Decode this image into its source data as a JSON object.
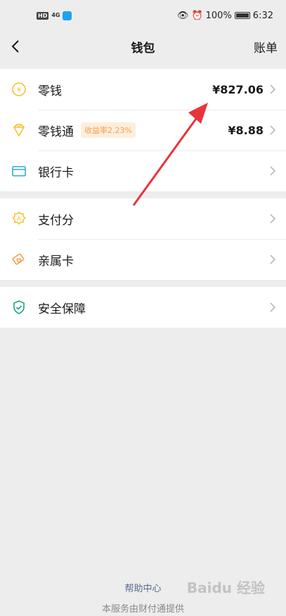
{
  "status_bar": {
    "hd": "HD",
    "signal": "4G",
    "battery_text": "100%",
    "time": "6:32"
  },
  "nav": {
    "title": "钱包",
    "right_action": "账单"
  },
  "wallet_items": [
    {
      "label": "零钱",
      "value": "¥827.06",
      "icon": "coin-icon"
    },
    {
      "label": "零钱通",
      "badge": "收益率2.23%",
      "value": "¥8.88",
      "icon": "diamond-icon"
    },
    {
      "label": "银行卡",
      "icon": "bank-card-icon"
    }
  ],
  "service_items": [
    {
      "label": "支付分",
      "icon": "pay-score-icon"
    },
    {
      "label": "亲属卡",
      "icon": "family-card-icon"
    }
  ],
  "security_items": [
    {
      "label": "安全保障",
      "icon": "shield-icon"
    }
  ],
  "footer": {
    "help": "帮助中心",
    "provider": "本服务由财付通提供"
  },
  "watermark": "Baidu 经验",
  "colors": {
    "background": "#ededed",
    "link": "#576b95",
    "badge_bg": "#fdeedd",
    "badge_text": "#f2a14a",
    "icon_yellow": "#f6c12e",
    "icon_blue": "#2aa8e6",
    "icon_orange": "#f29a4a",
    "icon_green": "#1ba784",
    "annotation_arrow": "#e8343b"
  }
}
